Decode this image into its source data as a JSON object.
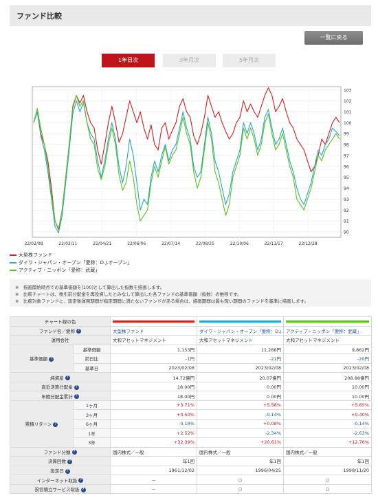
{
  "page": {
    "title": "ファンド比較",
    "back_button": "一覧に戻る",
    "tabs": [
      {
        "label": "1年日次",
        "active": true
      },
      {
        "label": "3年月次",
        "active": false
      },
      {
        "label": "5年月次",
        "active": false
      }
    ]
  },
  "colors": {
    "accent": "#c0141b",
    "fund1": "#d81c1c",
    "fund2": "#22a6d6",
    "fund3": "#5cc11a"
  },
  "chart_data": {
    "type": "line",
    "x_ticks": [
      "22/02/08",
      "22/03/11",
      "22/04/21",
      "22/06/06",
      "22/07/14",
      "22/08/25",
      "22/10/06",
      "22/11/17",
      "22/12/28"
    ],
    "y_ticks": [
      90,
      91,
      92,
      93,
      94,
      95,
      96,
      97,
      98,
      99,
      100,
      101,
      102,
      103
    ],
    "ylim": [
      89.5,
      103.3
    ],
    "grid": true,
    "series": [
      {
        "name": "大型株ファンド",
        "color": "#d81c1c",
        "values": [
          100,
          101,
          99,
          98,
          96.5,
          94,
          91,
          90.2,
          92,
          95,
          98,
          101.5,
          102.5,
          101.8,
          102.5,
          101,
          100,
          99.5,
          97.5,
          96.2,
          98,
          100,
          101.5,
          100,
          98.2,
          99,
          100.5,
          102,
          101,
          100,
          101,
          99.5,
          98.5,
          99.8,
          98,
          97.5,
          99.5,
          100,
          98.5,
          99.3,
          100,
          101.5,
          102.2,
          101,
          100.5,
          98.8,
          98,
          99,
          100.5,
          102.5,
          101.5,
          100.5,
          101,
          100,
          99.2,
          98.5,
          99,
          100,
          100.5,
          102,
          101,
          101.7,
          101,
          100.5,
          101.5,
          102.5,
          103.2,
          102.5,
          101,
          101.5,
          102.2,
          101,
          100,
          99.5,
          98.5,
          98,
          97.5,
          96.5,
          95.5,
          96,
          97,
          98.5,
          98,
          99,
          100,
          100.5,
          100
        ]
      },
      {
        "name": "ダイワ・ジャパン・オープン「愛称：D.J.オープン」",
        "color": "#22a6d6",
        "values": [
          100,
          101,
          98.8,
          97.5,
          95.5,
          93,
          90.5,
          89.9,
          91.5,
          94.5,
          97.5,
          100.8,
          102,
          101,
          101.8,
          100,
          99,
          98.5,
          96.5,
          95,
          96.5,
          98.5,
          100,
          98.5,
          96,
          94.5,
          96,
          98.5,
          97,
          94.5,
          92,
          93,
          92.5,
          95,
          96.5,
          95.5,
          97,
          98,
          96.5,
          97.5,
          98,
          99.5,
          101,
          99.5,
          98.5,
          96,
          95,
          95.5,
          98,
          100.5,
          99,
          96.5,
          95.5,
          94,
          92.5,
          93.5,
          95.5,
          96.5,
          97.5,
          100,
          99,
          100,
          99,
          97.5,
          98.5,
          100.5,
          101.2,
          99.5,
          98,
          98.5,
          99.5,
          98,
          96.5,
          95.5,
          94,
          93,
          92.5,
          93.5,
          94.5,
          96,
          97.5,
          97,
          98,
          98.5,
          99.5,
          99.2,
          98.8
        ]
      },
      {
        "name": "アクティブ・ニッポン「愛称：武蔵」",
        "color": "#5cc11a",
        "values": [
          100,
          101.3,
          99.5,
          98,
          96,
          93.5,
          91,
          90.3,
          92,
          95,
          98,
          101.3,
          102.5,
          101.5,
          102,
          100,
          98.5,
          98,
          95.8,
          94.8,
          96,
          98,
          99.5,
          98,
          95.2,
          93.8,
          94.5,
          96.5,
          95,
          92.5,
          91,
          91.5,
          92,
          94.5,
          96,
          95,
          96.5,
          97.8,
          96.2,
          97,
          97.5,
          99,
          100.5,
          99,
          98,
          95.5,
          94,
          95,
          97.5,
          100,
          98.5,
          95.5,
          94.5,
          93,
          91.5,
          92.5,
          95,
          96,
          97,
          99.5,
          98.5,
          99.5,
          98.5,
          97,
          98,
          100,
          100.8,
          99,
          97.5,
          98,
          99,
          97.5,
          96,
          95,
          93,
          92.5,
          92,
          93,
          94,
          95.5,
          97,
          96.5,
          97.5,
          98,
          98.5,
          99,
          98.5
        ]
      }
    ]
  },
  "notes": [
    "※　描画開始時点での基準価額を[100]として算出した指数を描画します。",
    "※　比較チャートは、税引前分配金を再投資したとみなして算出した各ファンドの基準価額（指数）の推移です。",
    "※　比較対象ファンドに、設定後運用期間が指定期間に満たないファンドがある場合は、描画期間は最も短い期間のファンドを基準に描画します。"
  ],
  "table": {
    "color_row_label": "チャート線の色",
    "fund_name_label": "ファンド名／愛称",
    "funds": [
      "大型株ファンド",
      "ダイワ・ジャパン・オープン「愛称：D.J.オープン」",
      "アクティブ・ニッポン「愛称：武蔵」"
    ],
    "company_label": "運用会社",
    "companies": [
      "大和アセットマネジメント",
      "大和アセットマネジメント",
      "大和アセットマネジメント"
    ],
    "nav_label": "基準価額",
    "nav_rows": [
      {
        "label": "基準価額",
        "values": [
          "1,153円",
          "11,266円",
          "9,862円"
        ]
      },
      {
        "label": "前日比",
        "values": [
          "-1円",
          "-21円",
          "-20円"
        ]
      },
      {
        "label": "基準日",
        "values": [
          "2023/02/08",
          "2023/02/08",
          "2023/02/08"
        ]
      }
    ],
    "single_rows": [
      {
        "label": "純資産",
        "values": [
          "14.72億円",
          "20.07億円",
          "208.88億円"
        ]
      },
      {
        "label": "直近決算分配金",
        "values": [
          "18.00円",
          "0.00円",
          "10.00円"
        ]
      },
      {
        "label": "年間分配金累計",
        "values": [
          "18.00円",
          "0.00円",
          "10.00円"
        ]
      }
    ],
    "return_label": "累積リターン",
    "return_rows": [
      {
        "label": "1ヶ月",
        "values": [
          "+3.71%",
          "+5.58%",
          "+5.65%"
        ]
      },
      {
        "label": "3ヶ月",
        "values": [
          "+0.50%",
          "-0.14%",
          "+0.40%"
        ]
      },
      {
        "label": "6ヶ月",
        "values": [
          "-0.18%",
          "+0.08%",
          "-0.14%"
        ]
      },
      {
        "label": "1年",
        "values": [
          "+2.52%",
          "-2.34%",
          "-2.63%"
        ]
      },
      {
        "label": "3年",
        "values": [
          "+32.39%",
          "+20.61%",
          "+12.76%"
        ]
      }
    ],
    "bottom_rows": [
      {
        "label": "ファンド分類",
        "values": [
          "国内株式／一般",
          "国内株式／一般",
          "国内株式／一般"
        ],
        "align": "lft"
      },
      {
        "label": "決算回数",
        "values": [
          "年1回",
          "年1回",
          "年1回"
        ],
        "align": "val"
      },
      {
        "label": "設定日",
        "values": [
          "1961/12/02",
          "1996/04/25",
          "1998/11/20"
        ],
        "align": "val"
      },
      {
        "label": "インターネット取扱",
        "values": [
          "－",
          "○",
          "○"
        ],
        "align": "center"
      },
      {
        "label": "投信積立サービス取扱",
        "values": [
          "－",
          "○",
          "○"
        ],
        "align": "center"
      }
    ],
    "help_glyph": "?"
  }
}
